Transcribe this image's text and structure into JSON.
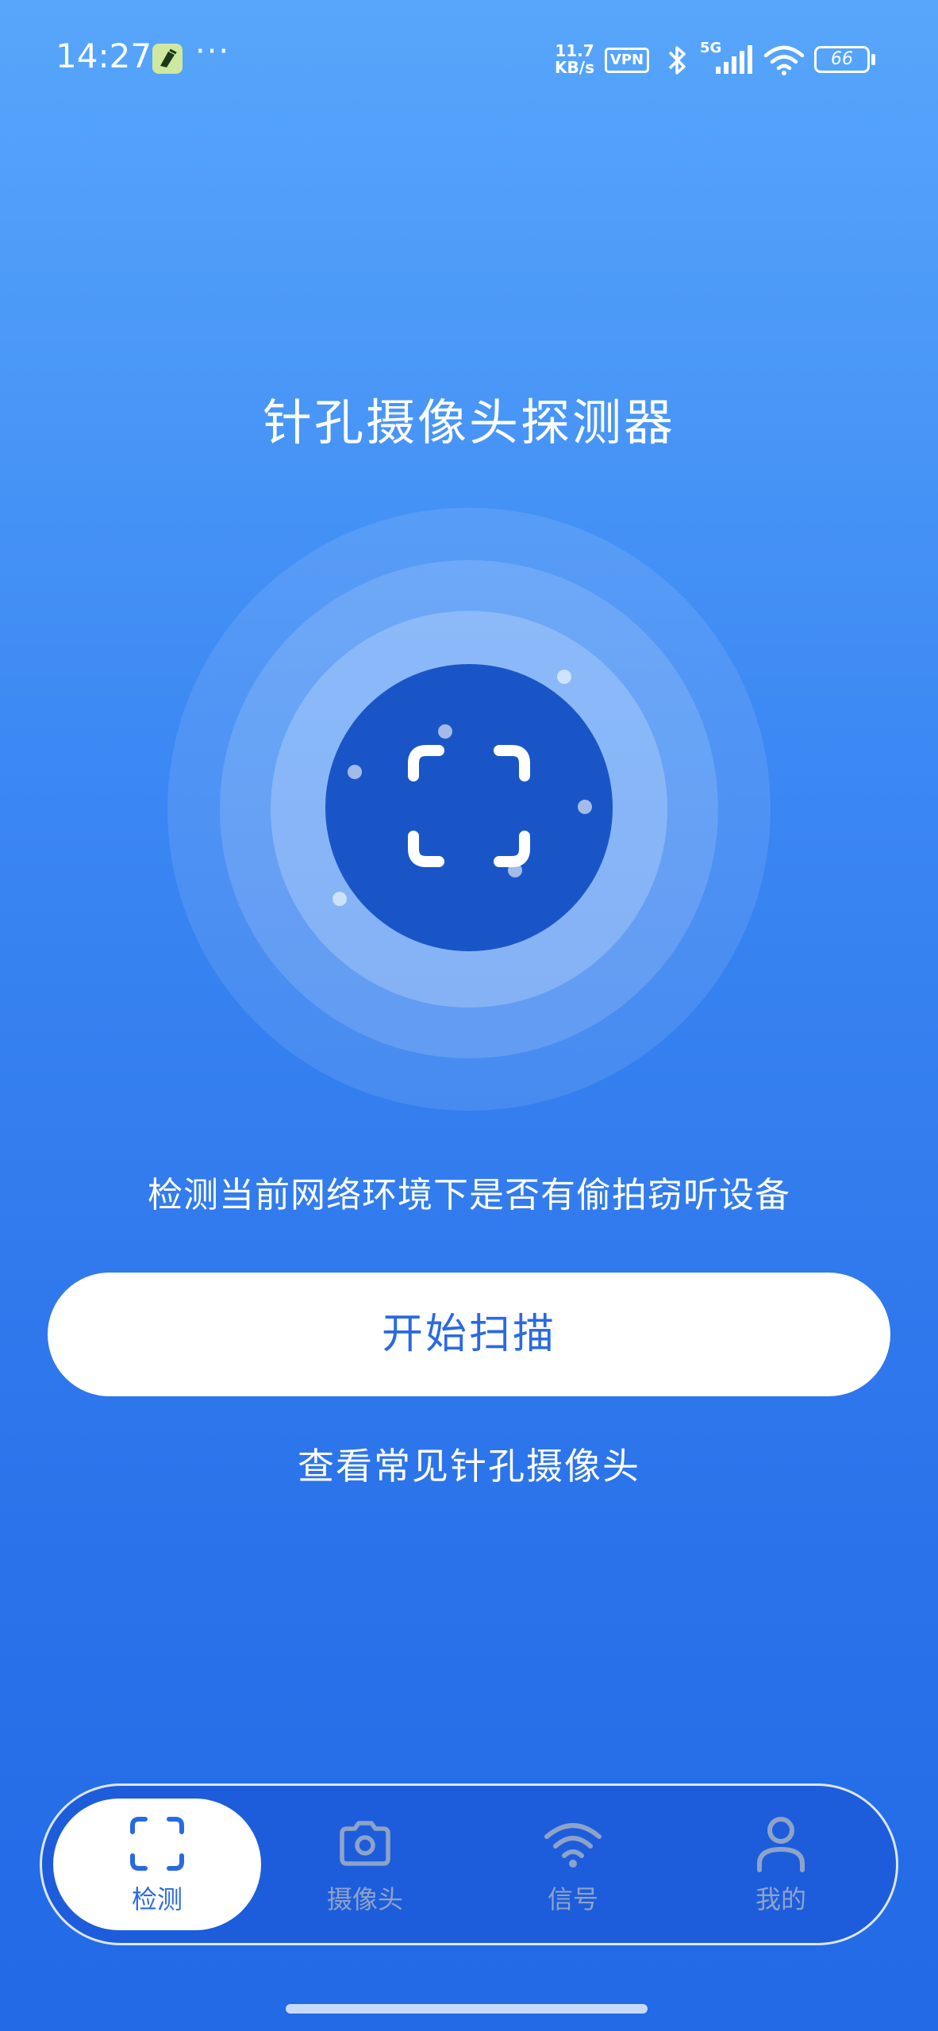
{
  "status_bar": {
    "time": "14:27",
    "more": "···",
    "net_speed_value": "11.7",
    "net_speed_unit": "KB/s",
    "vpn": "VPN",
    "network": "5G",
    "battery": "66"
  },
  "main": {
    "title": "针孔摄像头探测器",
    "subtitle": "检测当前网络环境下是否有偷拍窃听设备",
    "start_button_label": "开始扫描",
    "secondary_link": "查看常见针孔摄像头"
  },
  "bottom_nav": {
    "items": [
      {
        "label": "检测",
        "icon": "scan-icon",
        "active": true
      },
      {
        "label": "摄像头",
        "icon": "camera-icon",
        "active": false
      },
      {
        "label": "信号",
        "icon": "wifi-icon",
        "active": false
      },
      {
        "label": "我的",
        "icon": "user-icon",
        "active": false
      }
    ]
  },
  "colors": {
    "accent": "#2a6ae0",
    "core": "#1a55c8",
    "nav_bg": "#1d5ddb",
    "inactive_icon": "#8ea3c8"
  }
}
